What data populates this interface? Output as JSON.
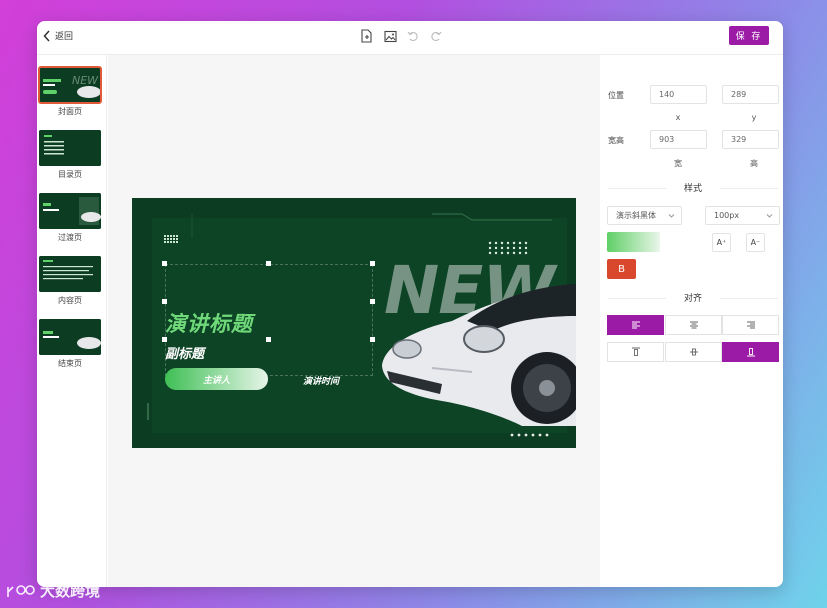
{
  "header": {
    "back_label": "返回",
    "save_label": "保 存"
  },
  "sidebar": {
    "slides": [
      {
        "label": "封面页",
        "active": true
      },
      {
        "label": "目录页",
        "active": false
      },
      {
        "label": "过渡页",
        "active": false
      },
      {
        "label": "内容页",
        "active": false
      },
      {
        "label": "结束页",
        "active": false
      }
    ]
  },
  "slide": {
    "title": "演讲标题",
    "subtitle": "副标题",
    "speaker": "主讲人",
    "time": "演讲时间",
    "bg_word": "NEW"
  },
  "panel": {
    "position_label": "位置",
    "x_value": "140",
    "y_value": "289",
    "x_label": "x",
    "y_label": "y",
    "size_label": "宽高",
    "width_value": "903",
    "height_value": "329",
    "width_label": "宽",
    "height_label": "高",
    "style_title": "样式",
    "font_family": "演示斜黑体",
    "font_size": "100px",
    "font_increase": "A⁺",
    "font_decrease": "A⁻",
    "bold_label": "B",
    "align_title": "对齐"
  },
  "colors": {
    "accent": "#9b1aa6",
    "slide_bg": "#0c3d22",
    "title_green": "#5fd36a",
    "bold_red": "#d9482d"
  },
  "watermark": {
    "text": "大数跨境"
  }
}
